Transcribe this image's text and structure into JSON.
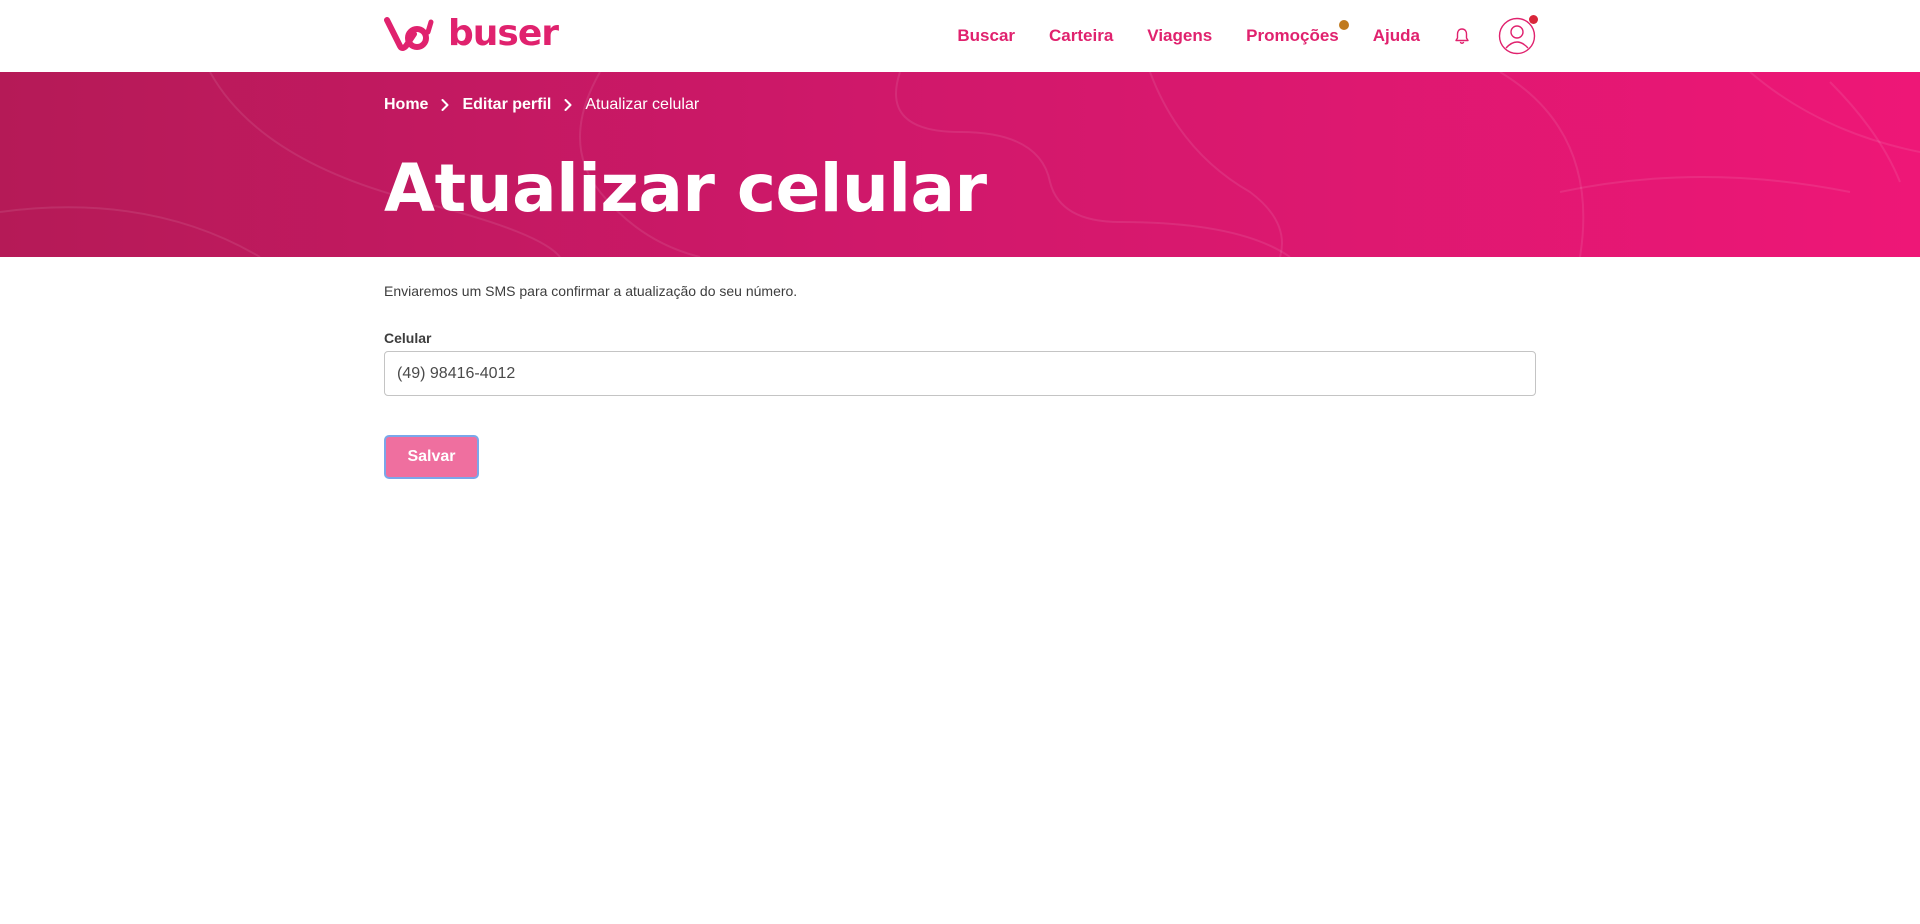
{
  "brand": {
    "name": "buser",
    "color": "#e0226e"
  },
  "nav": {
    "items": [
      {
        "label": "Buscar"
      },
      {
        "label": "Carteira"
      },
      {
        "label": "Viagens"
      },
      {
        "label": "Promoções"
      },
      {
        "label": "Ajuda"
      }
    ],
    "bell_icon": "bell-icon",
    "avatar_icon": "user-avatar-icon"
  },
  "breadcrumb": {
    "items": [
      {
        "label": "Home"
      },
      {
        "label": "Editar perfil"
      },
      {
        "label": "Atualizar celular"
      }
    ]
  },
  "page": {
    "title": "Atualizar celular",
    "description": "Enviaremos um SMS para confirmar a atualização do seu número."
  },
  "form": {
    "phone_label": "Celular",
    "phone_value": "(49) 98416-4012",
    "save_label": "Salvar"
  },
  "colors": {
    "accent": "#e0226e",
    "hero_start": "#b51a57",
    "hero_end": "#ee1777",
    "button_bg": "#ef6f9f",
    "promo_dot": "#c07a1e",
    "avatar_dot": "#d9263a"
  }
}
